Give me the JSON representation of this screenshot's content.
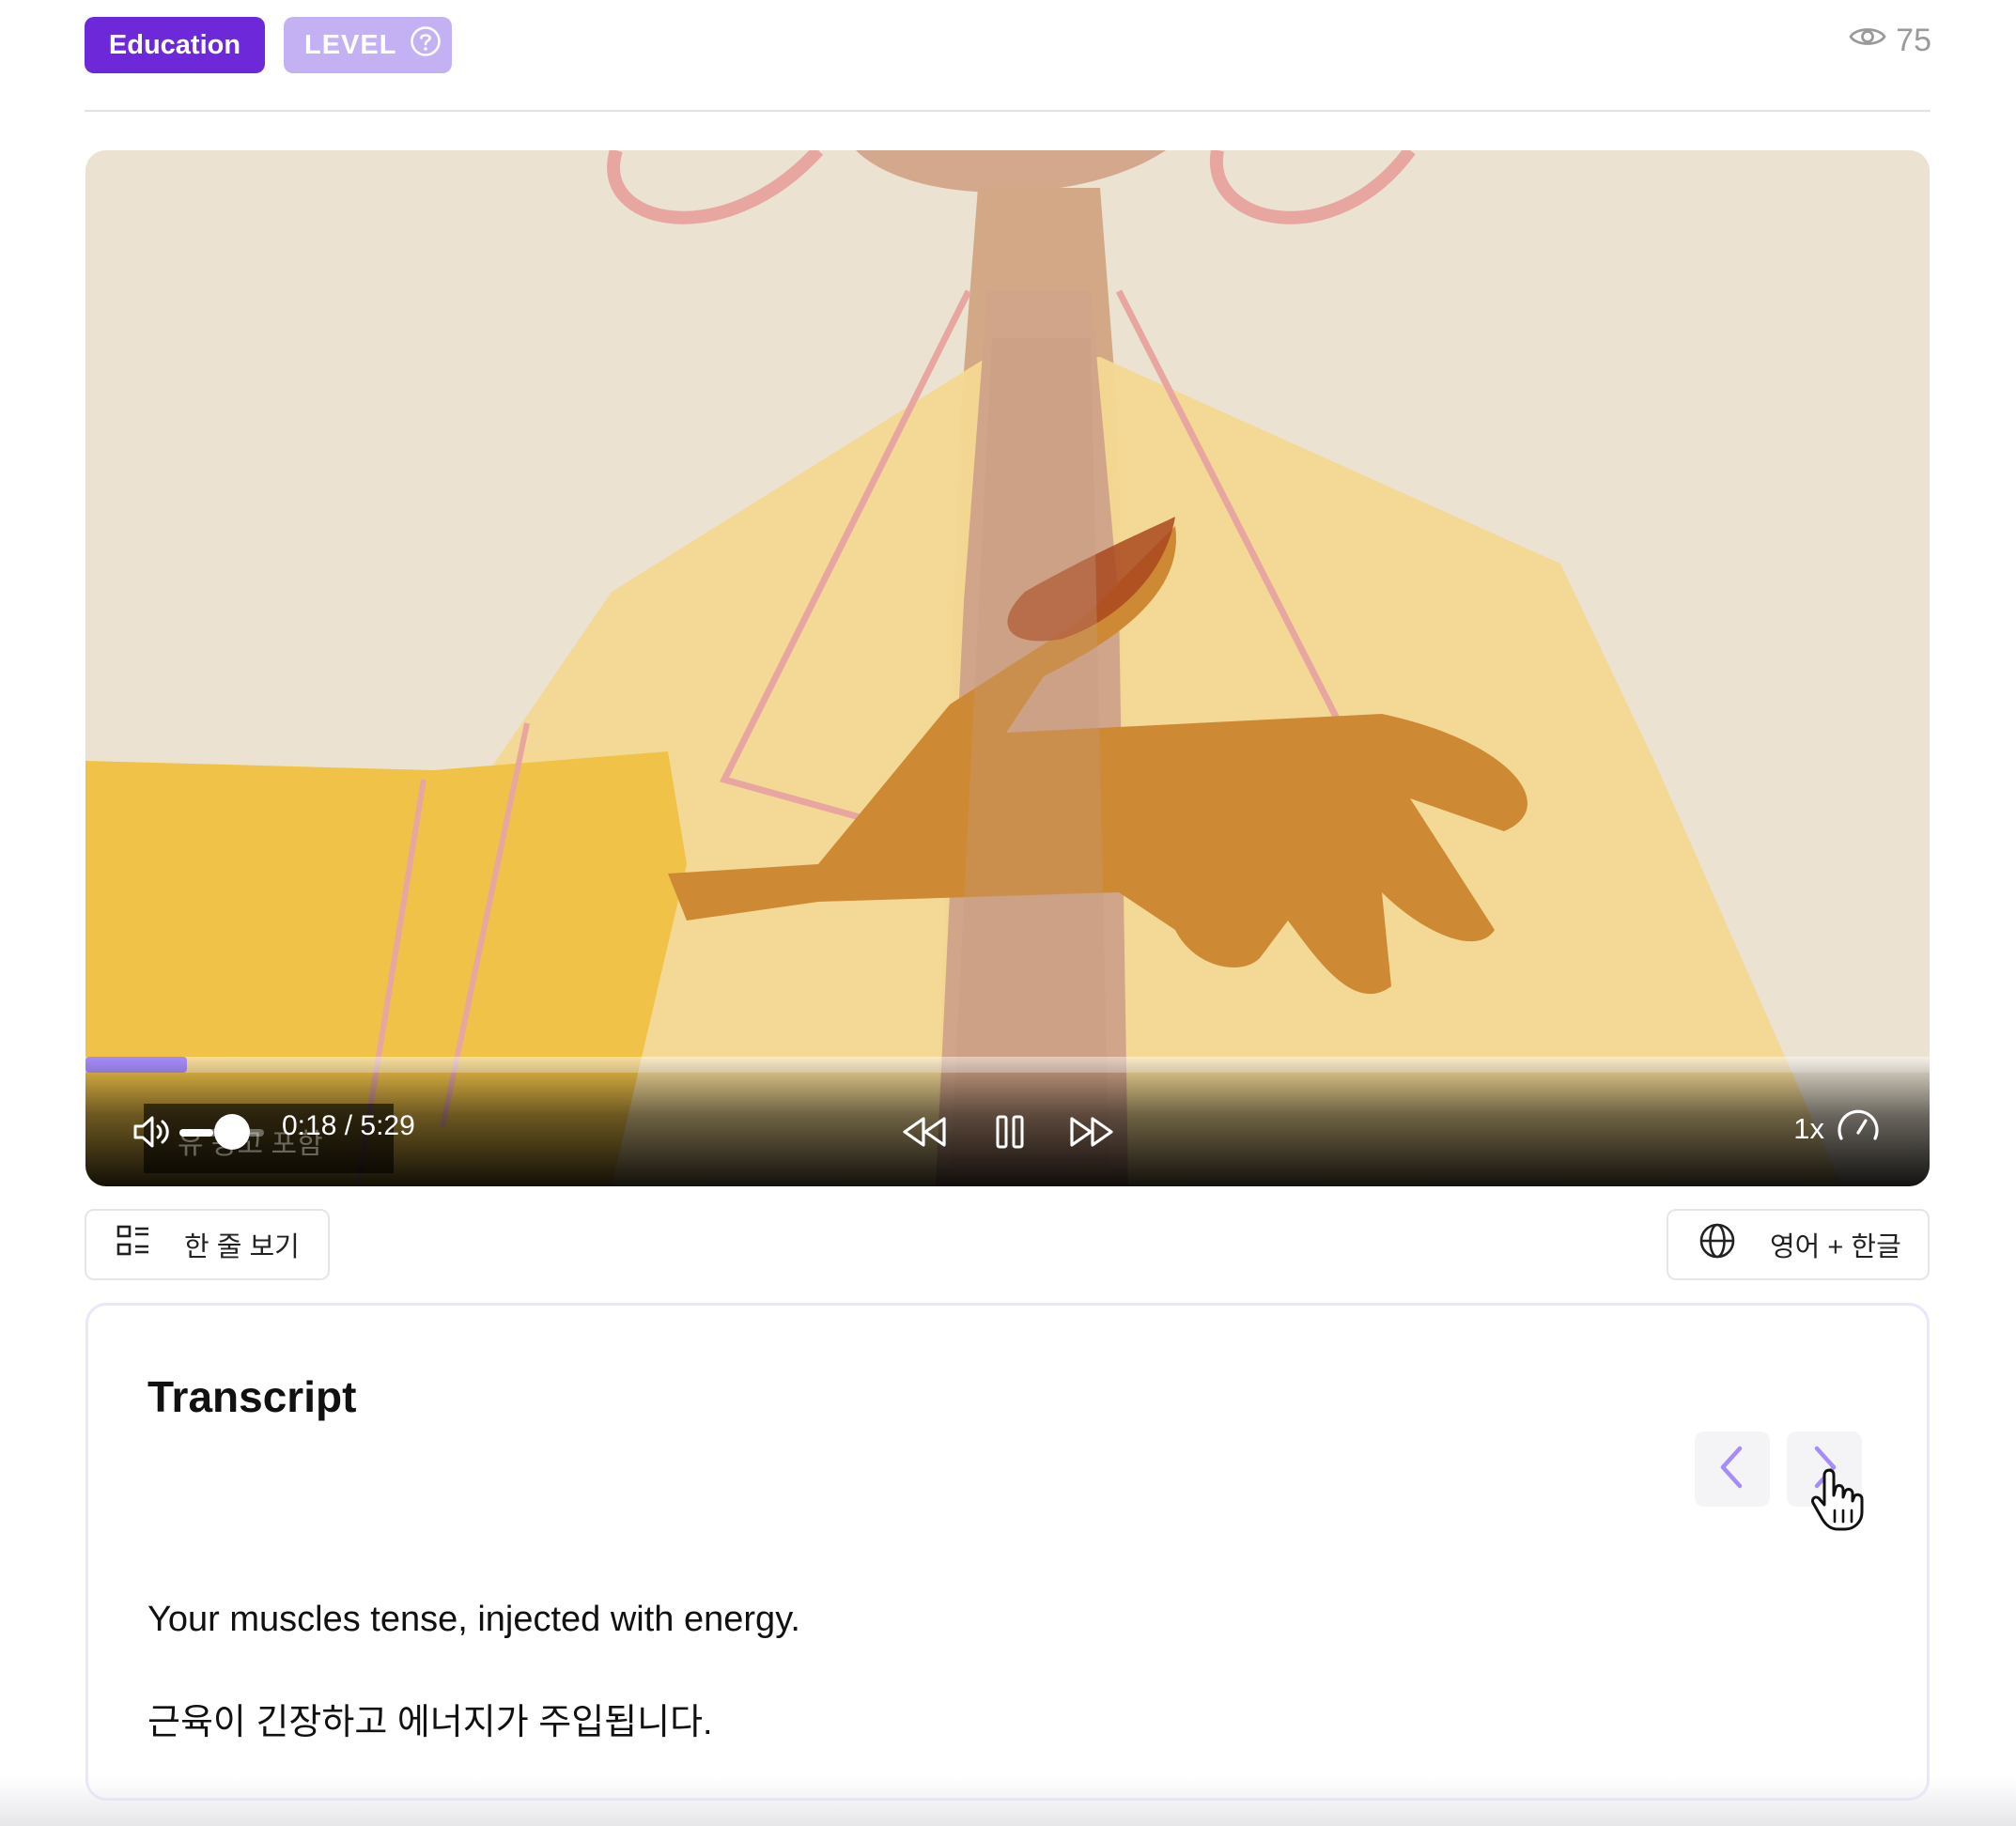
{
  "header": {
    "category_label": "Education",
    "level_label": "LEVEL",
    "view_count": "75"
  },
  "player": {
    "current_time": "0:18",
    "duration": "5:29",
    "time_display": "0:18 / 5:29",
    "progress_fraction": 0.055,
    "volume_fraction": 0.4,
    "speed_label": "1x",
    "subtitle_overlay": "유 광고 포함",
    "accent_color": "#a78bfa"
  },
  "toolbar": {
    "view_mode_label": "한 줄 보기",
    "language_label": "영어 + 한글"
  },
  "transcript": {
    "title": "Transcript",
    "english": "Your muscles tense, injected with energy.",
    "korean": "근육이 긴장하고 에너지가 주입됩니다."
  },
  "colors": {
    "brand_purple": "#6d28d9",
    "level_purple": "#c4b1f4",
    "nav_arrow": "#a78bfa"
  },
  "icons": {
    "views": "eye-icon",
    "level_help": "question-circle-icon",
    "volume": "volume-icon",
    "rewind": "rewind-icon",
    "pause": "pause-icon",
    "forward": "fast-forward-icon",
    "speed": "speedometer-icon",
    "view_mode": "list-layout-icon",
    "language": "globe-icon",
    "prev": "chevron-left-icon",
    "next": "chevron-right-icon",
    "cursor": "hand-pointer-icon"
  }
}
